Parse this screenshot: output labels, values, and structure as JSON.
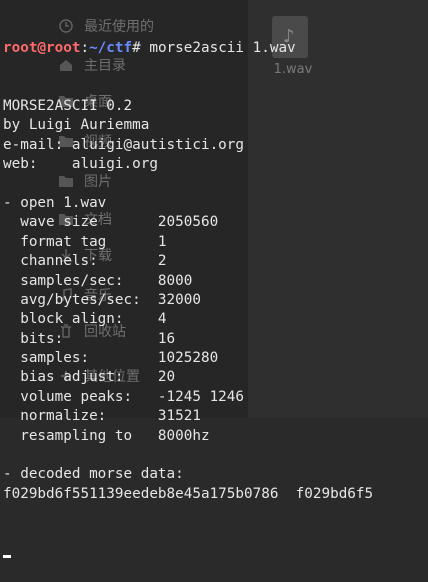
{
  "background": {
    "sidebar_items": [
      {
        "icon": "clock-icon",
        "label": "最近使用的"
      },
      {
        "icon": "home-icon",
        "label": "主目录"
      },
      {
        "icon": "folder-icon",
        "label": "桌面"
      },
      {
        "icon": "folder-icon",
        "label": "视频"
      },
      {
        "icon": "folder-icon",
        "label": "图片"
      },
      {
        "icon": "folder-icon",
        "label": "文档"
      },
      {
        "icon": "download-icon",
        "label": "下载"
      },
      {
        "icon": "music-icon",
        "label": "音乐"
      },
      {
        "icon": "trash-icon",
        "label": "回收站"
      },
      {
        "icon": "plus-icon",
        "label": "其他位置"
      }
    ],
    "file": {
      "icon": "audio-file-icon",
      "name": "1.wav"
    }
  },
  "terminal": {
    "prompt": {
      "user_host": "root@root",
      "sep": ":",
      "path": "~/ctf",
      "mark": "#",
      "command": " morse2ascii 1.wav"
    },
    "lines": [
      "MORSE2ASCII 0.2",
      "by Luigi Auriemma",
      "e-mail: aluigi@autistici.org",
      "web:    aluigi.org",
      "",
      "- open 1.wav",
      "  wave size       2050560",
      "  format tag      1",
      "  channels:       2",
      "  samples/sec:    8000",
      "  avg/bytes/sec:  32000",
      "  block align:    4",
      "  bits:           16",
      "  samples:        1025280",
      "  bias adjust:    20",
      "  volume peaks:   -1245 1246",
      "  normalize:      31521",
      "  resampling to   8000hz",
      "",
      "- decoded morse data:",
      "f029bd6f551139eedeb8e45a175b0786  f029bd6f5"
    ]
  },
  "colors": {
    "prompt_user": "#ff6b6b",
    "prompt_path": "#6b8bff",
    "text": "#e6e6e6"
  }
}
